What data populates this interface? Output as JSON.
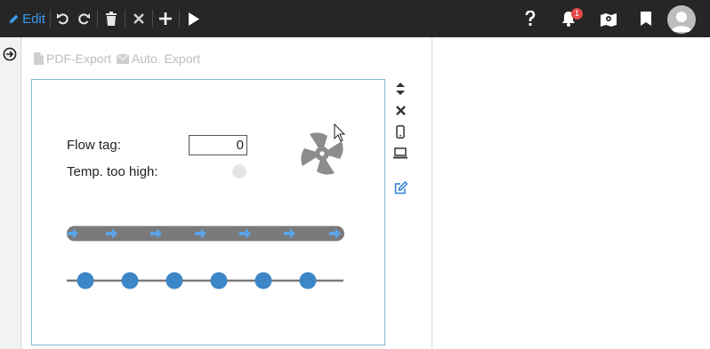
{
  "toolbar": {
    "edit_label": "Edit",
    "icons": [
      "pencil-icon",
      "undo-icon",
      "redo-icon",
      "trash-icon",
      "close-icon",
      "plus-icon",
      "play-icon",
      "help-icon",
      "bell-icon",
      "map-icon",
      "bookmark-icon",
      "avatar"
    ],
    "notification_count": "1"
  },
  "export_bar": {
    "pdf_label": "PDF-Export",
    "auto_label": "Auto. Export"
  },
  "canvas": {
    "flow_label": "Flow tag:",
    "flow_value": "0",
    "temp_label": "Temp. too high:"
  },
  "colors": {
    "topbar": "#262626",
    "accent": "#3b9cf2",
    "pipe": "#7a7a7a",
    "arrow": "#5aa4e6",
    "node": "#3d86c8",
    "fan": "#8c8c8c"
  }
}
